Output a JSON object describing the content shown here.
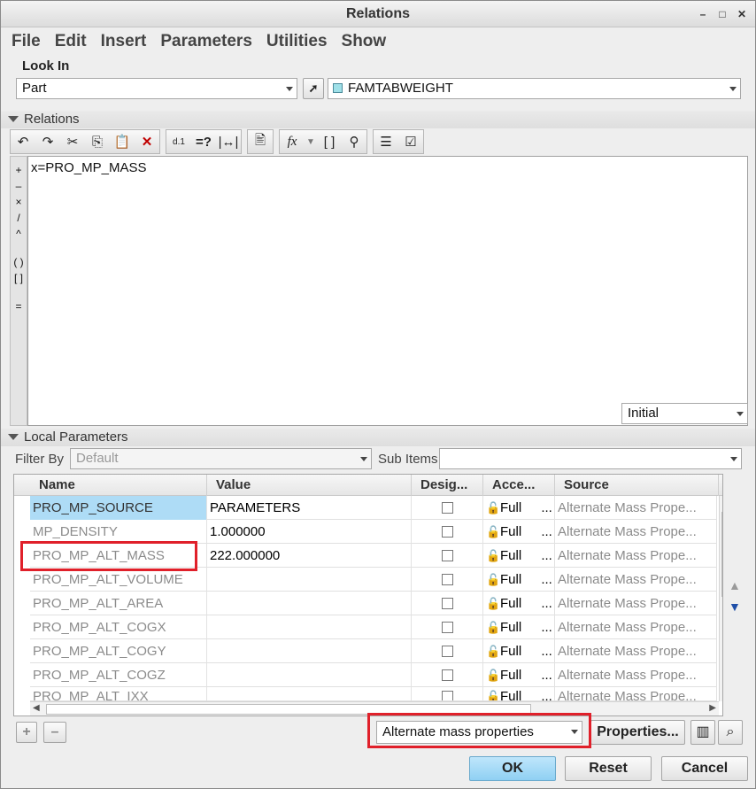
{
  "window": {
    "title": "Relations"
  },
  "menu": [
    "File",
    "Edit",
    "Insert",
    "Parameters",
    "Utilities",
    "Show"
  ],
  "look_in": {
    "label": "Look In",
    "type_value": "Part",
    "model_value": "FAMTABWEIGHT"
  },
  "relations": {
    "label": "Relations",
    "editor_text": "x=PRO_MP_MASS",
    "side_ops": [
      "+",
      "–",
      "×",
      "/",
      "^",
      "( )",
      "[ ]",
      "="
    ],
    "initial_value": "Initial"
  },
  "local_params": {
    "label": "Local Parameters",
    "filter_label": "Filter By",
    "filter_value": "Default",
    "subitems_label": "Sub Items",
    "columns": [
      "Name",
      "Value",
      "Desig...",
      "Acce...",
      "Source"
    ],
    "rows": [
      {
        "name": "PRO_MP_SOURCE",
        "value": "PARAMETERS",
        "access": "Full",
        "source": "Alternate Mass Prope..."
      },
      {
        "name": "MP_DENSITY",
        "value": "1.000000",
        "access": "Full",
        "source": "Alternate Mass Prope..."
      },
      {
        "name": "PRO_MP_ALT_MASS",
        "value": "222.000000",
        "access": "Full",
        "source": "Alternate Mass Prope..."
      },
      {
        "name": "PRO_MP_ALT_VOLUME",
        "value": "",
        "access": "Full",
        "source": "Alternate Mass Prope..."
      },
      {
        "name": "PRO_MP_ALT_AREA",
        "value": "",
        "access": "Full",
        "source": "Alternate Mass Prope..."
      },
      {
        "name": "PRO_MP_ALT_COGX",
        "value": "",
        "access": "Full",
        "source": "Alternate Mass Prope..."
      },
      {
        "name": "PRO_MP_ALT_COGY",
        "value": "",
        "access": "Full",
        "source": "Alternate Mass Prope..."
      },
      {
        "name": "PRO_MP_ALT_COGZ",
        "value": "",
        "access": "Full",
        "source": "Alternate Mass Prope..."
      },
      {
        "name": "PRO_MP_ALT_IXX",
        "value": "",
        "access": "Full",
        "source": "Alternate Mass Prope..."
      }
    ],
    "access_ellipsis": "...",
    "category_value": "Alternate mass properties",
    "properties_button": "Properties..."
  },
  "footer": {
    "ok": "OK",
    "reset": "Reset",
    "cancel": "Cancel"
  },
  "colors": {
    "selection": "#aedcf6",
    "highlight": "#e0202a",
    "ok_button": "#9fd7f5"
  }
}
